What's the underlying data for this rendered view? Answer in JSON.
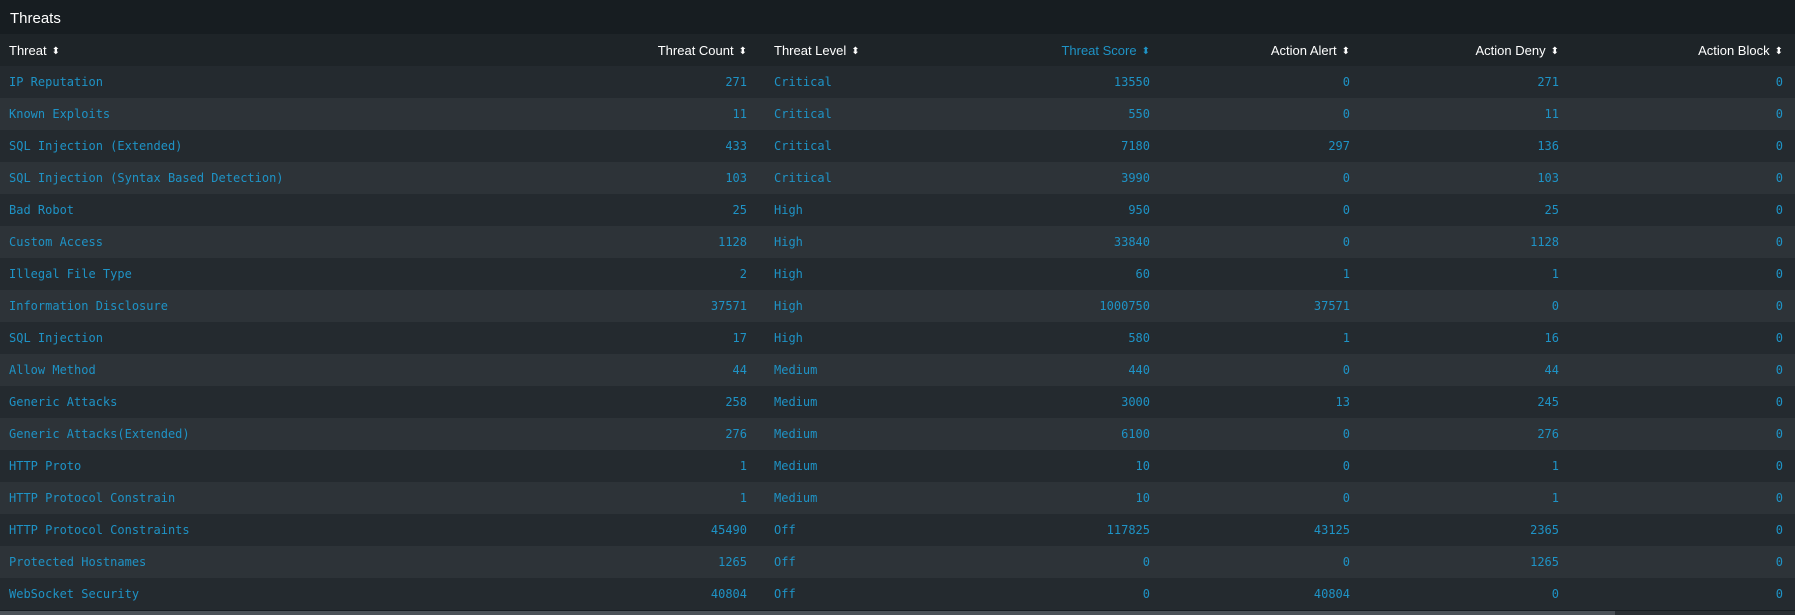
{
  "panel": {
    "title": "Threats"
  },
  "table": {
    "columns": [
      {
        "label": "Threat"
      },
      {
        "label": "Threat Count"
      },
      {
        "label": "Threat Level"
      },
      {
        "label": "Threat Score"
      },
      {
        "label": "Action Alert"
      },
      {
        "label": "Action Deny"
      },
      {
        "label": "Action Block"
      }
    ],
    "sort_icon": "⬍",
    "rows": [
      [
        "IP Reputation",
        "271",
        "Critical",
        "13550",
        "0",
        "271",
        "0"
      ],
      [
        "Known Exploits",
        "11",
        "Critical",
        "550",
        "0",
        "11",
        "0"
      ],
      [
        "SQL Injection (Extended)",
        "433",
        "Critical",
        "7180",
        "297",
        "136",
        "0"
      ],
      [
        "SQL Injection (Syntax Based Detection)",
        "103",
        "Critical",
        "3990",
        "0",
        "103",
        "0"
      ],
      [
        "Bad Robot",
        "25",
        "High",
        "950",
        "0",
        "25",
        "0"
      ],
      [
        "Custom Access",
        "1128",
        "High",
        "33840",
        "0",
        "1128",
        "0"
      ],
      [
        "Illegal File Type",
        "2",
        "High",
        "60",
        "1",
        "1",
        "0"
      ],
      [
        "Information Disclosure",
        "37571",
        "High",
        "1000750",
        "37571",
        "0",
        "0"
      ],
      [
        "SQL Injection",
        "17",
        "High",
        "580",
        "1",
        "16",
        "0"
      ],
      [
        "Allow Method",
        "44",
        "Medium",
        "440",
        "0",
        "44",
        "0"
      ],
      [
        "Generic Attacks",
        "258",
        "Medium",
        "3000",
        "13",
        "245",
        "0"
      ],
      [
        "Generic Attacks(Extended)",
        "276",
        "Medium",
        "6100",
        "0",
        "276",
        "0"
      ],
      [
        "HTTP Proto",
        "1",
        "Medium",
        "10",
        "0",
        "1",
        "0"
      ],
      [
        "HTTP Protocol Constrain",
        "1",
        "Medium",
        "10",
        "0",
        "1",
        "0"
      ],
      [
        "HTTP Protocol Constraints",
        "45490",
        "Off",
        "117825",
        "43125",
        "2365",
        "0"
      ],
      [
        "Protected Hostnames",
        "1265",
        "Off",
        "0",
        "0",
        "1265",
        "0"
      ],
      [
        "WebSocket Security",
        "40804",
        "Off",
        "0",
        "40804",
        "0",
        "0"
      ]
    ]
  },
  "colors": {
    "background": "#171d21",
    "header_background": "#1e2428",
    "row_odd": "#242a2f",
    "row_even": "#2d3338",
    "link_blue": "#1e93c6",
    "header_text": "#ffffff"
  }
}
